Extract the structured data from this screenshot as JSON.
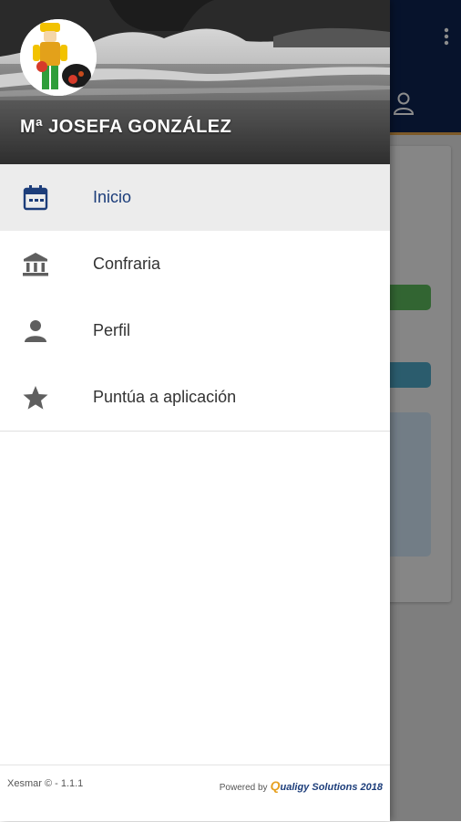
{
  "user": {
    "name": "Mª JOSEFA GONZÁLEZ"
  },
  "menu": {
    "items": [
      {
        "label": "Inicio",
        "icon": "calendar-icon",
        "active": true
      },
      {
        "label": "Confraria",
        "icon": "institution-icon",
        "active": false
      },
      {
        "label": "Perfil",
        "icon": "person-icon",
        "active": false
      },
      {
        "label": "Puntúa a aplicación",
        "icon": "star-icon",
        "active": false
      }
    ]
  },
  "footer": {
    "version": "Xesmar © - 1.1.1",
    "powered_by": "Powered by",
    "brand_initial": "Q",
    "brand_rest": "ualigy Solutions 2018"
  },
  "colors": {
    "topbar": "#0d2450",
    "accent": "#e4a44c",
    "active_text": "#1c3d7a",
    "brand_orange": "#e6a020"
  }
}
